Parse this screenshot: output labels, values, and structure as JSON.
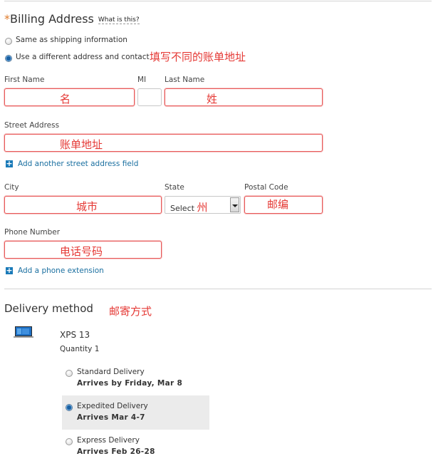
{
  "billing": {
    "required_mark": "*",
    "title": "Billing Address",
    "help_link": "What is this?",
    "options": [
      {
        "label": "Same as shipping information",
        "checked": false
      },
      {
        "label": "Use a different address and contact",
        "checked": true
      }
    ],
    "annotation": "填写不同的账单地址",
    "fields": {
      "first_name": {
        "label": "First Name",
        "value": "名"
      },
      "mi": {
        "label": "MI",
        "value": ""
      },
      "last_name": {
        "label": "Last Name",
        "value": "姓"
      },
      "street": {
        "label": "Street Address",
        "value": "账单地址"
      },
      "city": {
        "label": "City",
        "value": "城市"
      },
      "state": {
        "label": "State",
        "selected": "Select",
        "annotation": "州"
      },
      "postal": {
        "label": "Postal Code",
        "value": "邮编"
      },
      "phone": {
        "label": "Phone Number",
        "value": "电话号码"
      }
    },
    "add_street_link": "Add another street address field",
    "add_phone_link": "Add a phone extension"
  },
  "delivery": {
    "title": "Delivery method",
    "annotation": "邮寄方式",
    "product": {
      "name": "XPS 13",
      "quantity": "Quantity 1",
      "icon": "laptop-icon"
    },
    "options": [
      {
        "name": "Standard Delivery",
        "arrival": "Arrives by Friday, Mar 8",
        "checked": false
      },
      {
        "name": "Expedited Delivery",
        "arrival": "Arrives Mar 4-7",
        "checked": true
      },
      {
        "name": "Express Delivery",
        "arrival": "Arrives Feb 26-28",
        "checked": false
      }
    ]
  },
  "colors": {
    "accent": "#1a7ab8",
    "error": "#e85a5a",
    "annotation": "#e53935",
    "required": "#e07b2a"
  }
}
